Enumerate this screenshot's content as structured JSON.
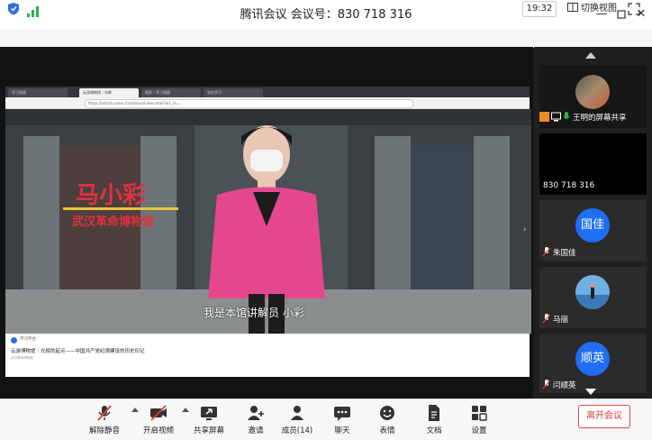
{
  "window": {
    "title": "腾讯会议 会议号：830 718 316"
  },
  "status": {
    "time": "19:32",
    "switch_view": "切换视图"
  },
  "browser": {
    "tabs": [
      "学习强国",
      "云游博物馆｜光辉",
      "搜索｜学习强国",
      "党史学习"
    ],
    "url": "https://article.xuexi.cn/articles/index.html?art_id=..."
  },
  "video": {
    "overlay_name": "马小彩",
    "overlay_subtitle": "武汉革命博物馆",
    "caption": "我是本馆讲解员 小彩"
  },
  "article": {
    "source": "学习平台",
    "title": "云游博物馆｜光辉的起点——中国共产党纪律建设的历史印记",
    "meta": "武汉革命博物馆"
  },
  "participants": [
    {
      "name": "王明的屏幕共享",
      "kind": "screen"
    },
    {
      "name": "830 718 316",
      "kind": "meeting-id"
    },
    {
      "name": "朱国佳",
      "avatar_text": "国佳",
      "kind": "circle"
    },
    {
      "name": "马丽",
      "kind": "photo"
    },
    {
      "name": "闫顺英",
      "avatar_text": "顺英",
      "kind": "circle"
    }
  ],
  "toolbar": {
    "unmute": "解除静音",
    "start_video": "开启视频",
    "share_screen": "共享屏幕",
    "invite": "邀请",
    "members": "成员(14)",
    "chat": "聊天",
    "reactions": "表情",
    "docs": "文档",
    "settings": "设置",
    "leave": "离开会议"
  },
  "colors": {
    "accent": "#1f6ff5",
    "danger": "#e03b3b",
    "signal": "#2fb14d"
  }
}
